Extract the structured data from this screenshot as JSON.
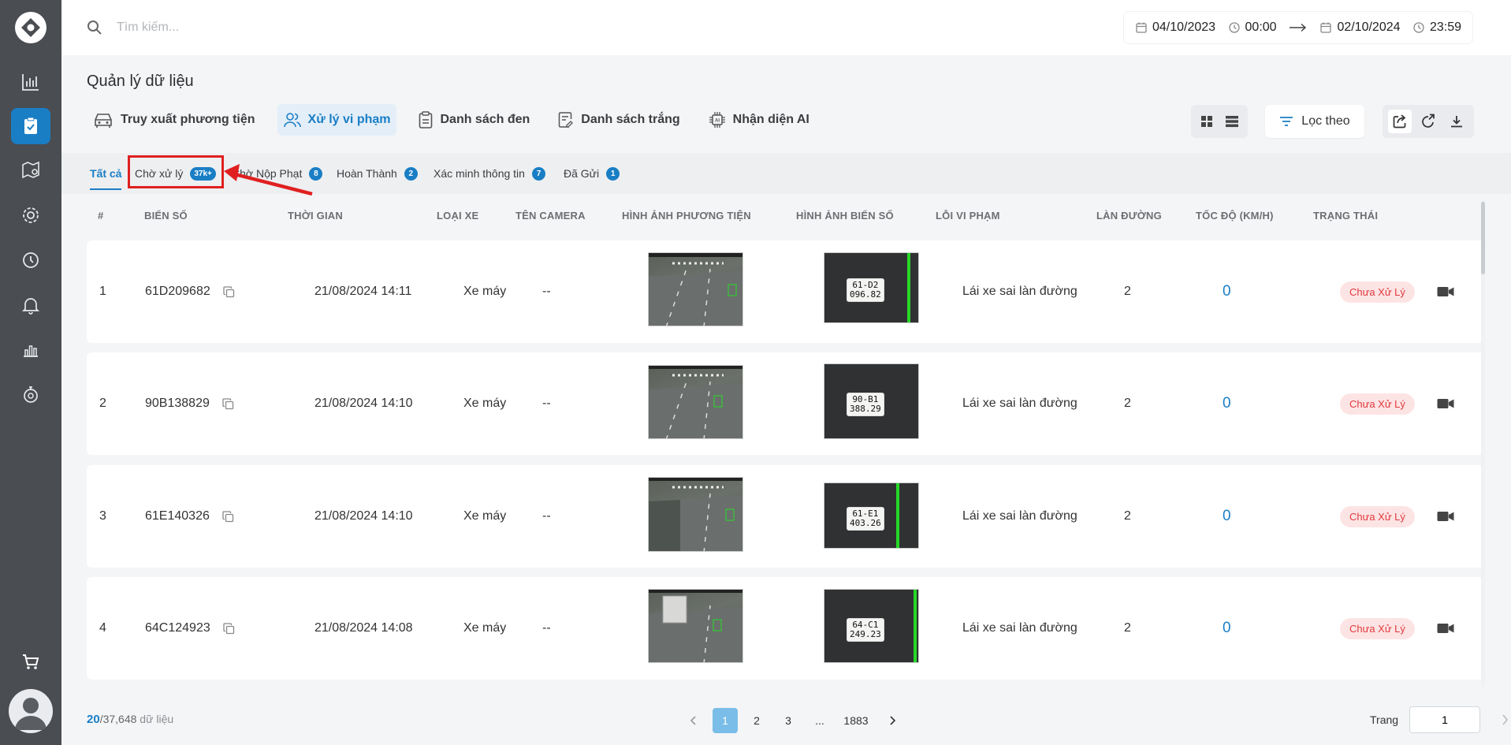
{
  "search": {
    "placeholder": "Tìm kiếm..."
  },
  "date_range": {
    "from_date": "04/10/2023",
    "from_time": "00:00",
    "to_date": "02/10/2024",
    "to_time": "23:59"
  },
  "page_title": "Quản lý dữ liệu",
  "module_tabs": [
    {
      "label": "Truy xuất phương tiện",
      "icon": "car-icon"
    },
    {
      "label": "Xử lý vi phạm",
      "icon": "users-icon",
      "active": true
    },
    {
      "label": "Danh sách đen",
      "icon": "clipboard-icon"
    },
    {
      "label": "Danh sách trắng",
      "icon": "checklist-icon"
    },
    {
      "label": "Nhận diện AI",
      "icon": "ai-chip-icon"
    }
  ],
  "filter": {
    "label": "Lọc theo"
  },
  "status_tabs": [
    {
      "label": "Tất cả",
      "active": true
    },
    {
      "label": "Chờ xử lý",
      "count": "37k+"
    },
    {
      "label": "Chờ Nộp Phạt",
      "count": "8"
    },
    {
      "label": "Hoàn Thành",
      "count": "2"
    },
    {
      "label": "Xác minh thông tin",
      "count": "7"
    },
    {
      "label": "Đã Gửi",
      "count": "1"
    }
  ],
  "columns": [
    "#",
    "BIỂN SỐ",
    "THỜI GIAN",
    "LOẠI XE",
    "TÊN CAMERA",
    "HÌNH ẢNH PHƯƠNG TIỆN",
    "HÌNH ẢNH BIỂN SỐ",
    "LỖI VI PHẠM",
    "LÀN ĐƯỜNG",
    "TỐC ĐỘ (KM/H)",
    "TRẠNG THÁI"
  ],
  "rows": [
    {
      "index": "1",
      "plate": "61D209682",
      "time": "21/08/2024 14:11",
      "vehicle_type": "Xe máy",
      "camera": "--",
      "plate_img_text": [
        "61-D2",
        "096.82"
      ],
      "violation": "Lái xe sai làn đường",
      "lane": "2",
      "speed": "0",
      "status": "Chưa Xử Lý"
    },
    {
      "index": "2",
      "plate": "90B138829",
      "time": "21/08/2024 14:10",
      "vehicle_type": "Xe máy",
      "camera": "--",
      "plate_img_text": [
        "90-B1",
        "388.29"
      ],
      "violation": "Lái xe sai làn đường",
      "lane": "2",
      "speed": "0",
      "status": "Chưa Xử Lý"
    },
    {
      "index": "3",
      "plate": "61E140326",
      "time": "21/08/2024 14:10",
      "vehicle_type": "Xe máy",
      "camera": "--",
      "plate_img_text": [
        "61-E1",
        "403.26"
      ],
      "violation": "Lái xe sai làn đường",
      "lane": "2",
      "speed": "0",
      "status": "Chưa Xử Lý"
    },
    {
      "index": "4",
      "plate": "64C124923",
      "time": "21/08/2024 14:08",
      "vehicle_type": "Xe máy",
      "camera": "--",
      "plate_img_text": [
        "64-C1",
        "249.23"
      ],
      "violation": "Lái xe sai làn đường",
      "lane": "2",
      "speed": "0",
      "status": "Chưa Xử Lý"
    }
  ],
  "footer": {
    "shown": "20",
    "total": "/37,648",
    "unit": " dữ liệu",
    "pages": [
      "1",
      "2",
      "3",
      "...",
      "1883"
    ],
    "page_label": "Trang",
    "page_value": "1"
  },
  "colors": {
    "accent": "#1a7ec5",
    "sidebar": "#4a4d51",
    "status_bg": "#fde4e4",
    "status_text": "#e0393e",
    "highlight": "#e02020"
  }
}
